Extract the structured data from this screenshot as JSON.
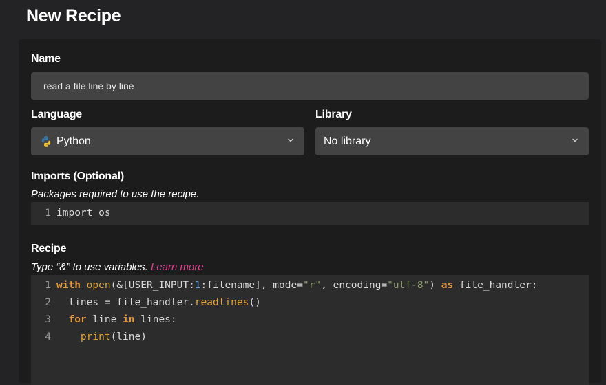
{
  "page": {
    "title": "New Recipe"
  },
  "form": {
    "name": {
      "label": "Name",
      "value": "read a file line by line"
    },
    "language": {
      "label": "Language",
      "selected": "Python",
      "icon": "python-icon"
    },
    "library": {
      "label": "Library",
      "selected": "No library"
    },
    "imports": {
      "label": "Imports (Optional)",
      "hint": "Packages required to use the recipe.",
      "lines": [
        {
          "num": "1",
          "text": "import os"
        }
      ]
    },
    "recipe": {
      "label": "Recipe",
      "hint": "Type “&” to use variables.",
      "learn_more": "Learn more",
      "line_numbers": [
        "1",
        "2",
        "3",
        "4"
      ],
      "tokens": {
        "l1_with": "with",
        "l1_open": "open",
        "l1_a": "(&[USER_INPUT:",
        "l1_num": "1",
        "l1_b": ":filename], mode=",
        "l1_str1": "\"r\"",
        "l1_c": ", encoding=",
        "l1_str2": "\"utf-8\"",
        "l1_d": ") ",
        "l1_as": "as",
        "l1_e": " file_handler:",
        "l2_a": "  lines = file_handler.",
        "l2_fn": "readlines",
        "l2_b": "()",
        "l3_for": "for",
        "l3_a": " line ",
        "l3_in": "in",
        "l3_b": " lines:",
        "l4_fn": "print",
        "l4_a": "(line)"
      }
    }
  },
  "colors": {
    "background": "#232325",
    "card": "#1c1c1c",
    "field": "#434343",
    "code_bg": "#2c2c2c",
    "link": "#e0418f",
    "keyword": "#e39a3d"
  }
}
